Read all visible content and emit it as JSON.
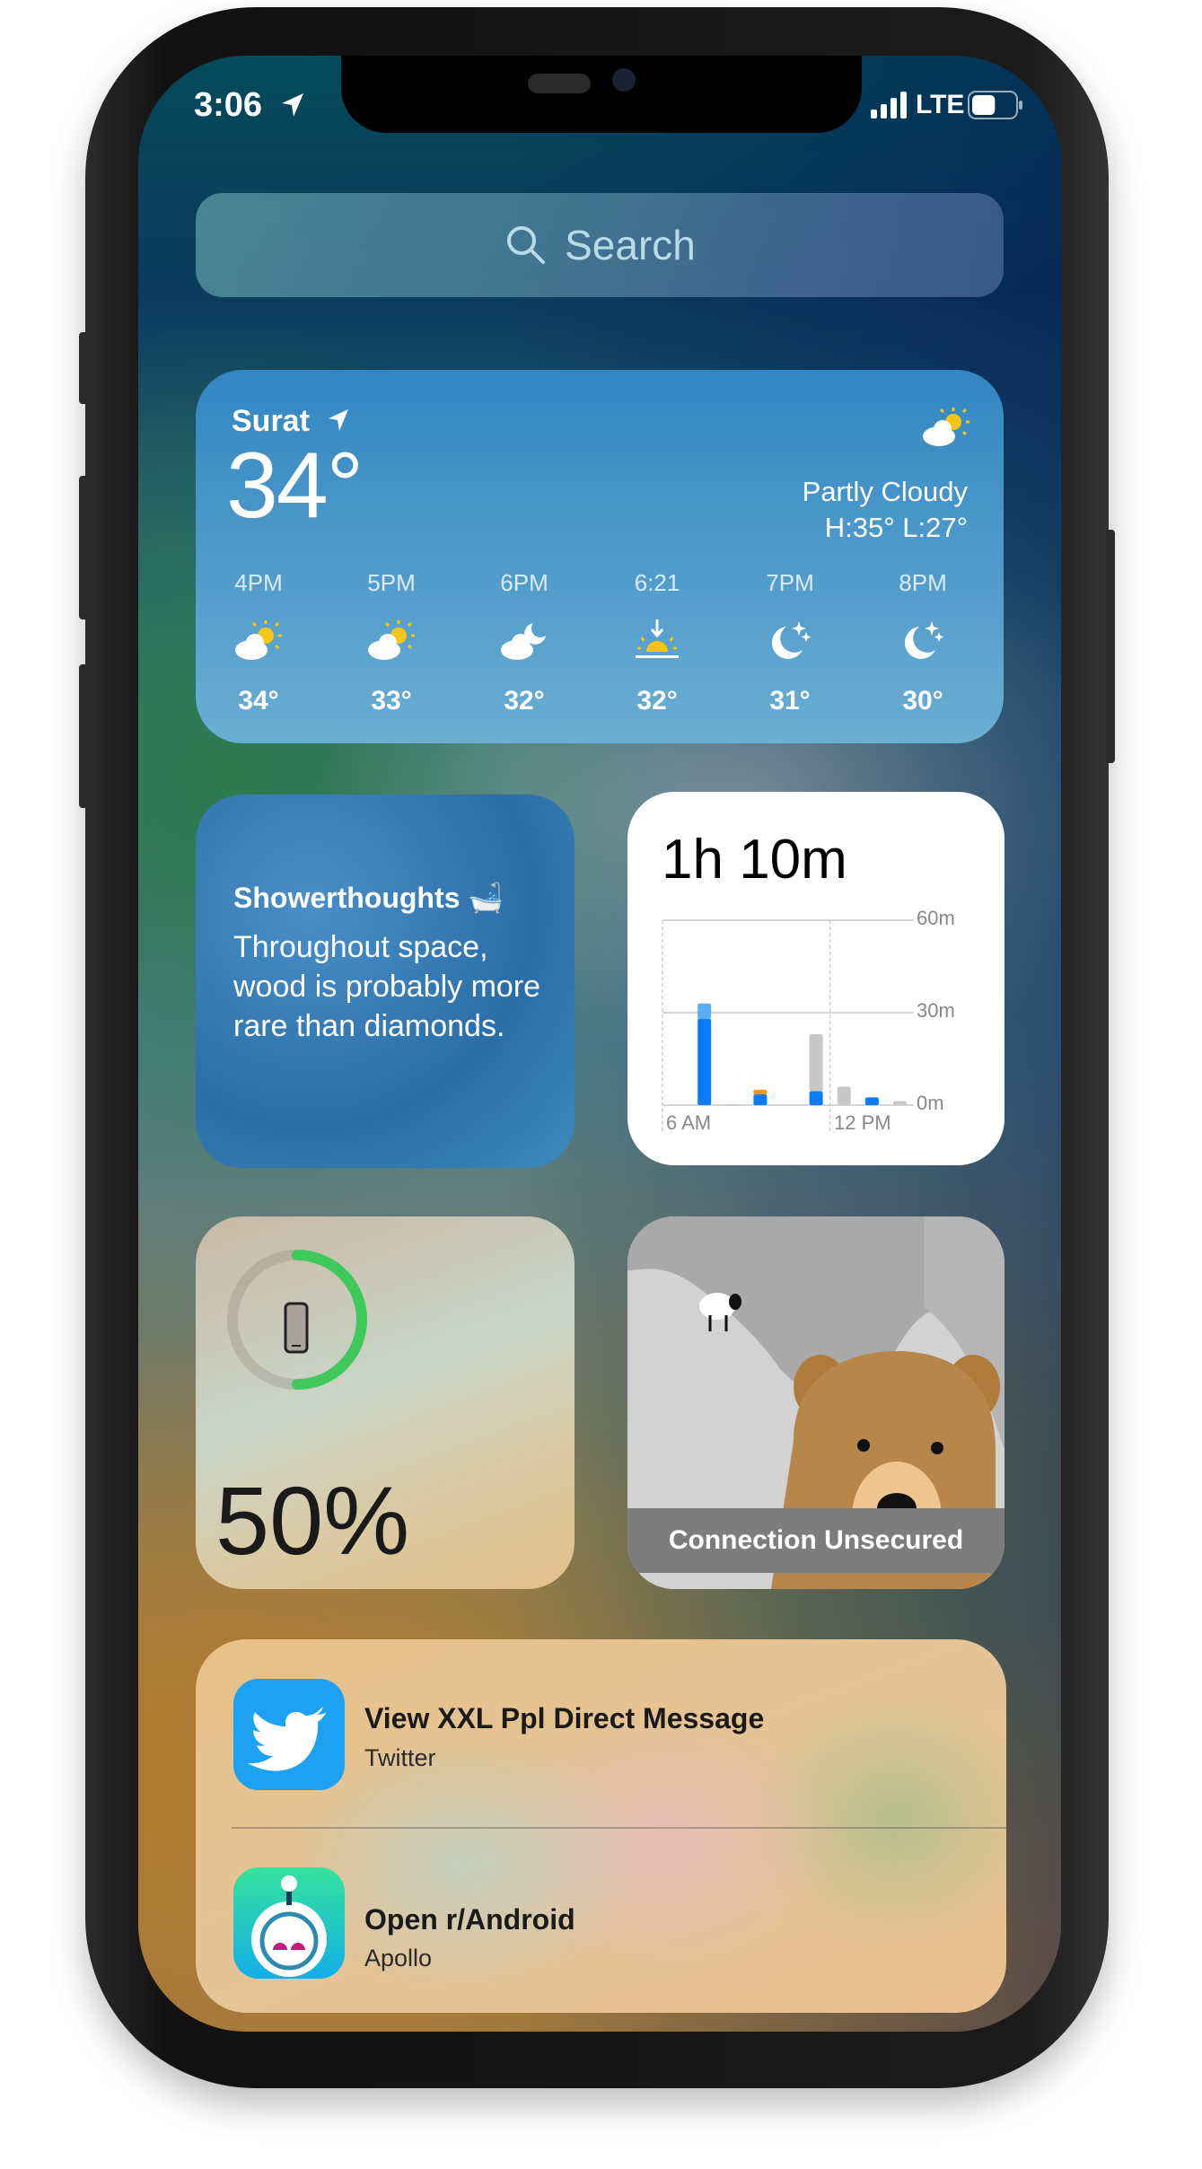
{
  "status_bar": {
    "time": "3:06",
    "network": "LTE",
    "battery_level": 0.55
  },
  "search": {
    "placeholder": "Search"
  },
  "weather": {
    "city": "Surat",
    "temperature": "34°",
    "condition": "Partly Cloudy",
    "high_low": "H:35° L:27°",
    "hourly": [
      {
        "time": "4PM",
        "icon": "partly-cloudy-sun-icon",
        "temp": "34°"
      },
      {
        "time": "5PM",
        "icon": "partly-cloudy-sun-icon",
        "temp": "33°"
      },
      {
        "time": "6PM",
        "icon": "partly-cloudy-moon-icon",
        "temp": "32°"
      },
      {
        "time": "6:21",
        "icon": "sunset-icon",
        "temp": "32°"
      },
      {
        "time": "7PM",
        "icon": "moon-stars-icon",
        "temp": "31°"
      },
      {
        "time": "8PM",
        "icon": "moon-stars-icon",
        "temp": "30°"
      }
    ]
  },
  "showerthoughts": {
    "title": "Showerthoughts 🛁",
    "body": "Throughout space, wood is probably more rare than diamonds."
  },
  "screen_time": {
    "total": "1h 10m",
    "chart_data": {
      "type": "bar",
      "stacked": true,
      "ylim": [
        0,
        60
      ],
      "y_ticks": [
        "60m",
        "30m",
        "0m"
      ],
      "x_ticks": [
        "6 AM",
        "12 PM"
      ],
      "colors": {
        "blue": "#0a7cff",
        "light_blue": "#5aaef5",
        "orange": "#ff9500",
        "gray": "#c8c8c8"
      },
      "slots": [
        {
          "blue": 0,
          "light_blue": 0,
          "orange": 0,
          "gray": 0
        },
        {
          "blue": 28,
          "light_blue": 5,
          "orange": 0,
          "gray": 0
        },
        {
          "blue": 0,
          "light_blue": 0,
          "orange": 0,
          "gray": 0.3
        },
        {
          "blue": 3.5,
          "light_blue": 0,
          "orange": 1.5,
          "gray": 0
        },
        {
          "blue": 0,
          "light_blue": 0,
          "orange": 0,
          "gray": 0
        },
        {
          "blue": 4.5,
          "light_blue": 0,
          "orange": 0,
          "gray": 18.5
        },
        {
          "blue": 0,
          "light_blue": 0,
          "orange": 0,
          "gray": 6
        },
        {
          "blue": 2.5,
          "light_blue": 0,
          "orange": 0,
          "gray": 0
        },
        {
          "blue": 0,
          "light_blue": 0,
          "orange": 0,
          "gray": 1.3
        }
      ]
    }
  },
  "battery_widget": {
    "percent_label": "50%",
    "level": 0.5,
    "ring_color": "#3ec95a"
  },
  "tunnelbear": {
    "status": "Connection Unsecured"
  },
  "siri_suggestions": [
    {
      "title": "View XXL Ppl Direct Message",
      "app": "Twitter",
      "icon": "twitter-bird-icon"
    },
    {
      "title": "Open r/Android",
      "app": "Apollo",
      "icon": "apollo-robot-icon"
    }
  ]
}
